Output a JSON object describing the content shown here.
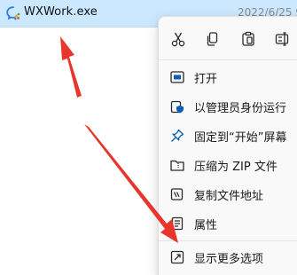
{
  "file": {
    "name": "WXWork.exe",
    "date": "2022/6/25 9:",
    "icon": "wxwork-app-icon"
  },
  "quick_actions": [
    {
      "name": "cut",
      "icon": "scissors-icon"
    },
    {
      "name": "copy",
      "icon": "copy-icon"
    },
    {
      "name": "paste",
      "icon": "clipboard-icon"
    },
    {
      "name": "rename",
      "icon": "rename-icon"
    }
  ],
  "menu": {
    "items": [
      {
        "label": "打开",
        "icon": "open-icon"
      },
      {
        "label": "以管理员身份运行",
        "icon": "shield-run-icon"
      },
      {
        "label": "固定到“开始”屏幕",
        "icon": "pin-icon"
      },
      {
        "label": "压缩为 ZIP 文件",
        "icon": "zip-folder-icon"
      },
      {
        "label": "复制文件地址",
        "icon": "copy-path-icon"
      },
      {
        "label": "属性",
        "icon": "properties-icon"
      },
      {
        "label": "显示更多选项",
        "icon": "more-options-icon"
      }
    ]
  },
  "colors": {
    "selection": "#cce8ff",
    "menu_bg": "#f9f9f9",
    "accent": "#0a5fb4",
    "arrow": "#e8362d"
  }
}
